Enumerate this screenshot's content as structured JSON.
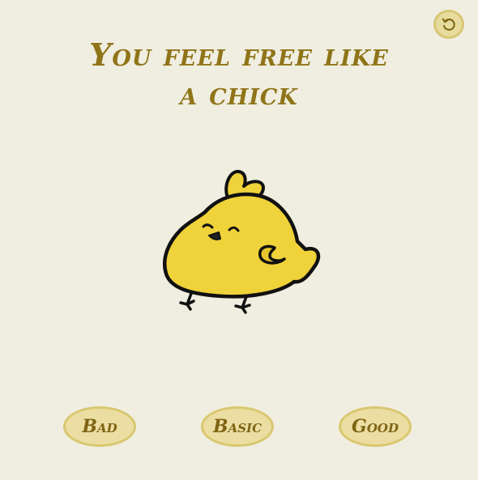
{
  "title": {
    "line1": "You feel free like",
    "line2": "a chick"
  },
  "reset_button": {
    "icon": "refresh-icon"
  },
  "ratings": {
    "bad": "Bad",
    "basic": "Basic",
    "good": "Good"
  },
  "colors": {
    "background": "#f0eee0",
    "title": "#8f7418",
    "button_fill": "#ecdea2",
    "button_border": "#d9c76f",
    "chick_body": "#f0d23a"
  }
}
